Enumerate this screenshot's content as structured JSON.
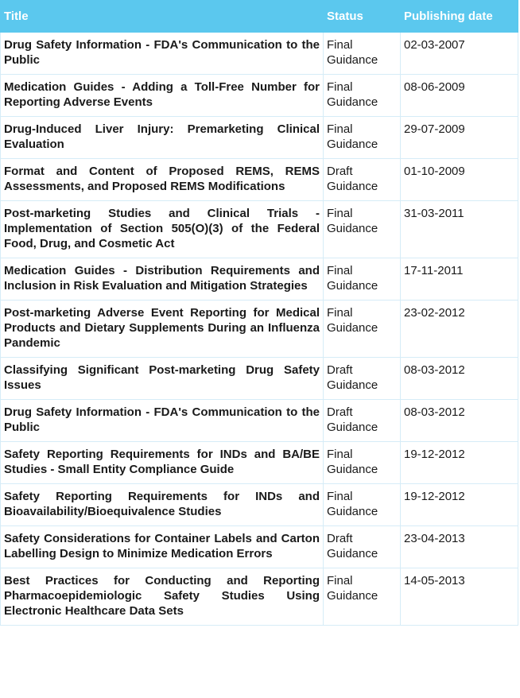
{
  "table": {
    "headers": [
      "Title",
      "Status",
      "Publishing date"
    ],
    "rows": [
      {
        "title": "Drug Safety Information - FDA's Communication to the Public",
        "status": "Final Guidance",
        "date": "02-03-2007"
      },
      {
        "title": "Medication Guides - Adding a Toll-Free Number for Reporting Adverse Events",
        "status": "Final Guidance",
        "date": "08-06-2009"
      },
      {
        "title": "Drug-Induced Liver Injury: Premarketing Clinical Evaluation",
        "status": "Final Guidance",
        "date": "29-07-2009"
      },
      {
        "title": "Format and Content of Proposed REMS, REMS Assessments, and Proposed REMS Modifications",
        "status": "Draft Guidance",
        "date": "01-10-2009"
      },
      {
        "title": "Post-marketing Studies and Clinical Trials - Implementation of Section 505(O)(3) of the Federal Food, Drug, and Cosmetic Act",
        "status": "Final Guidance",
        "date": "31-03-2011"
      },
      {
        "title": "Medication Guides - Distribution Requirements and Inclusion in Risk Evaluation and Mitigation Strategies",
        "status": "Final Guidance",
        "date": "17-11-2011"
      },
      {
        "title": "Post-marketing Adverse Event Reporting for Medical Products and Dietary Supplements During an Influenza Pandemic",
        "status": "Final Guidance",
        "date": "23-02-2012"
      },
      {
        "title": "Classifying Significant Post-marketing Drug Safety Issues",
        "status": "Draft Guidance",
        "date": "08-03-2012"
      },
      {
        "title": "Drug Safety Information - FDA's Communication to the Public",
        "status": "Draft Guidance",
        "date": "08-03-2012"
      },
      {
        "title": "Safety Reporting Requirements for INDs and BA/BE Studies - Small Entity Compliance Guide",
        "status": "Final Guidance",
        "date": "19-12-2012"
      },
      {
        "title": "Safety Reporting Requirements for INDs and Bioavailability/Bioequivalence Studies",
        "status": "Final Guidance",
        "date": "19-12-2012"
      },
      {
        "title": "Safety Considerations for Container Labels and Carton Labelling Design to Minimize Medication Errors",
        "status": "Draft Guidance",
        "date": "23-04-2013"
      },
      {
        "title": "Best Practices for Conducting and Reporting Pharmacoepidemiologic Safety Studies Using Electronic Healthcare Data Sets",
        "status": "Final Guidance",
        "date": "14-05-2013"
      }
    ]
  }
}
